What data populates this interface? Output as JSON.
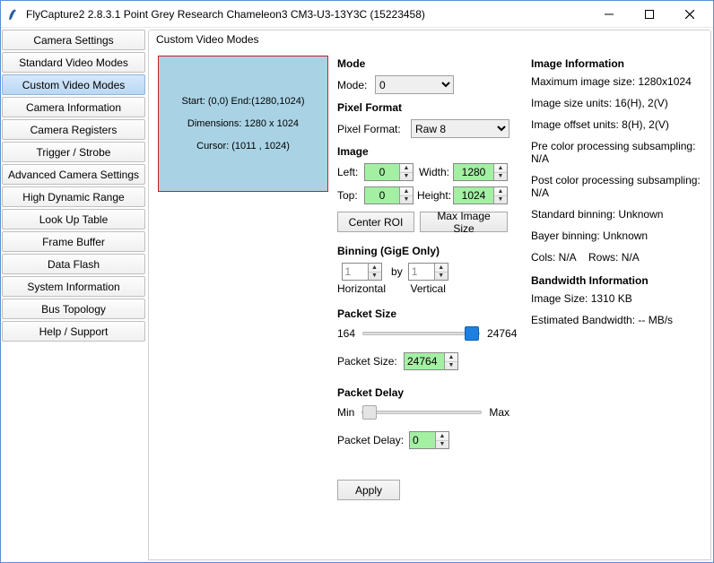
{
  "window": {
    "title": "FlyCapture2 2.8.3.1  Point Grey Research Chameleon3 CM3-U3-13Y3C (15223458)"
  },
  "sidebar": {
    "items": [
      {
        "label": "Camera Settings"
      },
      {
        "label": "Standard Video Modes"
      },
      {
        "label": "Custom Video Modes"
      },
      {
        "label": "Camera Information"
      },
      {
        "label": "Camera Registers"
      },
      {
        "label": "Trigger / Strobe"
      },
      {
        "label": "Advanced Camera Settings"
      },
      {
        "label": "High Dynamic Range"
      },
      {
        "label": "Look Up Table"
      },
      {
        "label": "Frame Buffer"
      },
      {
        "label": "Data Flash"
      },
      {
        "label": "System Information"
      },
      {
        "label": "Bus Topology"
      },
      {
        "label": "Help / Support"
      }
    ],
    "active_index": 2
  },
  "panel": {
    "title": "Custom Video Modes"
  },
  "preview": {
    "line1": "Start: (0,0) End:(1280,1024)",
    "line2": "Dimensions: 1280 x 1024",
    "line3": "Cursor: (1011 , 1024)"
  },
  "mode": {
    "heading": "Mode",
    "label": "Mode:",
    "value": "0"
  },
  "pixel_format": {
    "heading": "Pixel Format",
    "label": "Pixel Format:",
    "value": "Raw 8"
  },
  "image": {
    "heading": "Image",
    "left_label": "Left:",
    "left": "0",
    "width_label": "Width:",
    "width": "1280",
    "top_label": "Top:",
    "top": "0",
    "height_label": "Height:",
    "height": "1024",
    "center_roi": "Center ROI",
    "max_image_size": "Max Image Size"
  },
  "binning": {
    "heading": "Binning (GigE Only)",
    "h": "1",
    "by": "by",
    "v": "1",
    "h_label": "Horizontal",
    "v_label": "Vertical"
  },
  "packet_size": {
    "heading": "Packet Size",
    "min": "164",
    "max": "24764",
    "label": "Packet Size:",
    "value": "24764"
  },
  "packet_delay": {
    "heading": "Packet Delay",
    "min": "Min",
    "max": "Max",
    "label": "Packet Delay:",
    "value": "0"
  },
  "apply": {
    "label": "Apply"
  },
  "info": {
    "heading1": "Image Information",
    "max_size": "Maximum image size: 1280x1024",
    "size_units": "Image size units: 16(H), 2(V)",
    "offset_units": "Image offset units: 8(H), 2(V)",
    "pre_sub": "Pre color processing subsampling: N/A",
    "post_sub": "Post color processing subsampling: N/A",
    "std_binning": "Standard binning: Unknown",
    "bayer_binning": "Bayer binning: Unknown",
    "cols_rows": "Cols: N/A    Rows: N/A",
    "heading2": "Bandwidth Information",
    "img_size": "Image Size: 1310 KB",
    "bandwidth": "Estimated Bandwidth: -- MB/s"
  }
}
